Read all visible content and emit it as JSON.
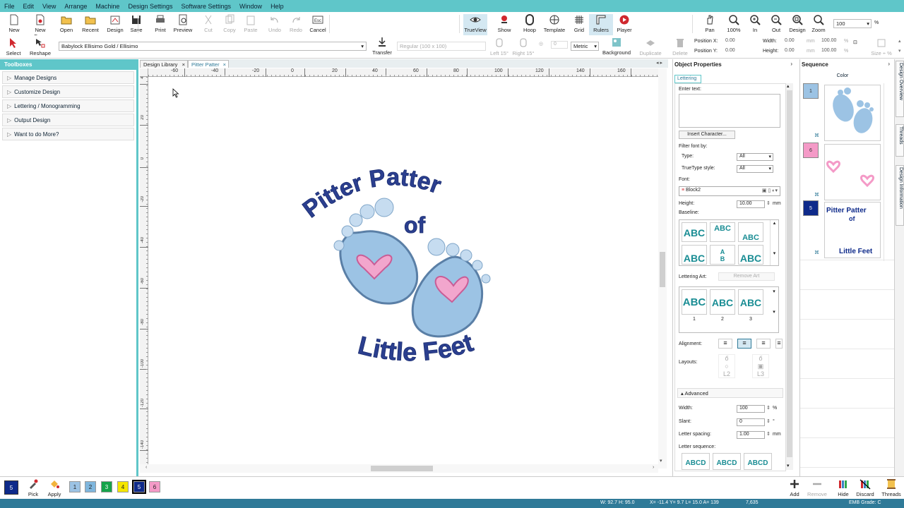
{
  "menu": [
    "File",
    "Edit",
    "View",
    "Arrange",
    "Machine",
    "Design Settings",
    "Software Settings",
    "Window",
    "Help"
  ],
  "toolbar1": {
    "left": [
      {
        "label": "New",
        "icon": "new-file-icon"
      },
      {
        "label": "New From",
        "icon": "new-from-icon"
      },
      {
        "label": "Open",
        "icon": "open-folder-icon"
      },
      {
        "label": "Recent",
        "icon": "recent-folder-icon"
      },
      {
        "label": "Design",
        "icon": "design-icon"
      },
      {
        "label": "Save",
        "icon": "save-icon"
      },
      {
        "label": "Print",
        "icon": "print-icon"
      },
      {
        "label": "Preview",
        "icon": "preview-icon"
      },
      {
        "label": "Cut",
        "icon": "cut-icon"
      },
      {
        "label": "Copy",
        "icon": "copy-icon"
      },
      {
        "label": "Paste",
        "icon": "paste-icon"
      },
      {
        "label": "Undo",
        "icon": "undo-icon"
      },
      {
        "label": "Redo",
        "icon": "redo-icon"
      },
      {
        "label": "Cancel",
        "icon": "cancel-esc-icon"
      }
    ],
    "view": [
      {
        "label": "TrueView",
        "icon": "trueview-eye-icon"
      },
      {
        "label": "Show",
        "icon": "show-icon"
      },
      {
        "label": "Hoop",
        "icon": "hoop-icon"
      },
      {
        "label": "Template",
        "icon": "template-icon"
      },
      {
        "label": "Grid",
        "icon": "grid-icon"
      },
      {
        "label": "Rulers",
        "icon": "rulers-icon"
      },
      {
        "label": "Player",
        "icon": "player-icon"
      }
    ],
    "zoomtools": [
      {
        "label": "Pan",
        "icon": "pan-hand-icon"
      },
      {
        "label": "100%",
        "icon": "zoom-100-icon"
      },
      {
        "label": "In",
        "icon": "zoom-in-icon"
      },
      {
        "label": "Out",
        "icon": "zoom-out-icon"
      },
      {
        "label": "Design",
        "icon": "zoom-design-icon"
      },
      {
        "label": "Zoom",
        "icon": "zoom-icon"
      }
    ],
    "zoom_value": "100",
    "zoom_unit": "%"
  },
  "toolbar2": {
    "select_label": "Select",
    "reshape_label": "Reshape",
    "font_combo": "Babylock Ellisimo Gold / Ellisimo",
    "transfer_label": "Transfer",
    "style_combo": "Regular (100 x 100)",
    "left15": "Left 15°",
    "right15": "Right 15°",
    "angle_value": "0",
    "units_combo": "Metric",
    "background_label": "Background",
    "duplicate_label": "Duplicate",
    "delete_label": "Delete",
    "posx_label": "Position X:",
    "posx_value": "0.00",
    "posy_label": "Position Y:",
    "posy_value": "0.00",
    "width_label": "Width:",
    "width_value": "0.00",
    "height_label": "Height:",
    "height_value": "0.00",
    "pct_w": "100.00",
    "pct_h": "100.00",
    "unit_mm": "mm",
    "unit_pct": "%",
    "size_label": "Size ÷ %"
  },
  "leftpanel": {
    "title": "Toolboxes",
    "items": [
      "Manage Designs",
      "Customize Design",
      "Lettering / Monogramming",
      "Output Design",
      "Want to do More?"
    ]
  },
  "tabs": [
    {
      "label": "Design Library"
    },
    {
      "label": "Pitter Patter"
    }
  ],
  "ruler": {
    "h_ticks": [
      "-60",
      "-40",
      "-20",
      "0",
      "20",
      "40",
      "60",
      "80",
      "100",
      "120",
      "140",
      "160"
    ],
    "v_ticks": [
      "40",
      "20",
      "0",
      "-20",
      "-40",
      "-60",
      "-80",
      "-100",
      "-120",
      "-140"
    ]
  },
  "design": {
    "line1": "Pitter Patter",
    "line2": "of",
    "line3": "Little Feet",
    "text_color": "#2b3f8f",
    "foot_color": "#9cc3e4",
    "heart_color": "#f2a6cd"
  },
  "objprops": {
    "title": "Object Properties",
    "tab": "Lettering",
    "enter_text_label": "Enter text:",
    "enter_text_value": "",
    "insert_char": "Insert Character...",
    "filter_label": "Filter font by:",
    "type_label": "Type:",
    "type_value": "All",
    "tt_label": "TrueType style:",
    "tt_value": "All",
    "font_label": "Font:",
    "font_value": "Block2",
    "height_label": "Height:",
    "height_value": "10.00",
    "height_unit": "mm",
    "baseline_label": "Baseline:",
    "baseline_sample": "ABC",
    "lettering_art_label": "Lettering Art:",
    "remove_art": "Remove Art",
    "art_items": [
      "1",
      "2",
      "3"
    ],
    "alignment_label": "Alignment:",
    "layouts_label": "Layouts:",
    "advanced_label": "Advanced",
    "width_label": "Width:",
    "width_value": "100",
    "width_unit": "%",
    "slant_label": "Slant:",
    "slant_value": "0",
    "slant_unit": "°",
    "spacing_label": "Letter spacing:",
    "spacing_value": "1.00",
    "spacing_unit": "mm",
    "sequence_label": "Letter sequence:",
    "sequence_sample": "ABCD"
  },
  "sequence": {
    "title": "Sequence",
    "color_header": "Color",
    "items": [
      {
        "num": "1",
        "color": "#9cc3e4"
      },
      {
        "num": "6",
        "color": "#f49ac7"
      },
      {
        "num": "5",
        "color": "#0e2a8a"
      }
    ]
  },
  "sidetabs": [
    "Design Overview",
    "Threads",
    "Design Information"
  ],
  "bottombar": {
    "current_color": "5",
    "pick_label": "Pick",
    "apply_label": "Apply",
    "chips": [
      {
        "num": "1",
        "color": "#9cc3e4"
      },
      {
        "num": "2",
        "color": "#7fb6dd"
      },
      {
        "num": "3",
        "color": "#16a34a"
      },
      {
        "num": "4",
        "color": "#f5e600"
      },
      {
        "num": "5",
        "color": "#0e2a8a"
      },
      {
        "num": "6",
        "color": "#f49ac7"
      }
    ],
    "add_label": "Add",
    "remove_label": "Remove",
    "hide_label": "Hide",
    "discard_label": "Discard",
    "threads_label": "Threads"
  },
  "status": {
    "wh": "W: 92.7 H: 95.0",
    "xy": "X= -11.4 Y= 9.7 L= 15.0 A= 139",
    "stitches": "7,635",
    "grade": "EMB Grade: C"
  }
}
